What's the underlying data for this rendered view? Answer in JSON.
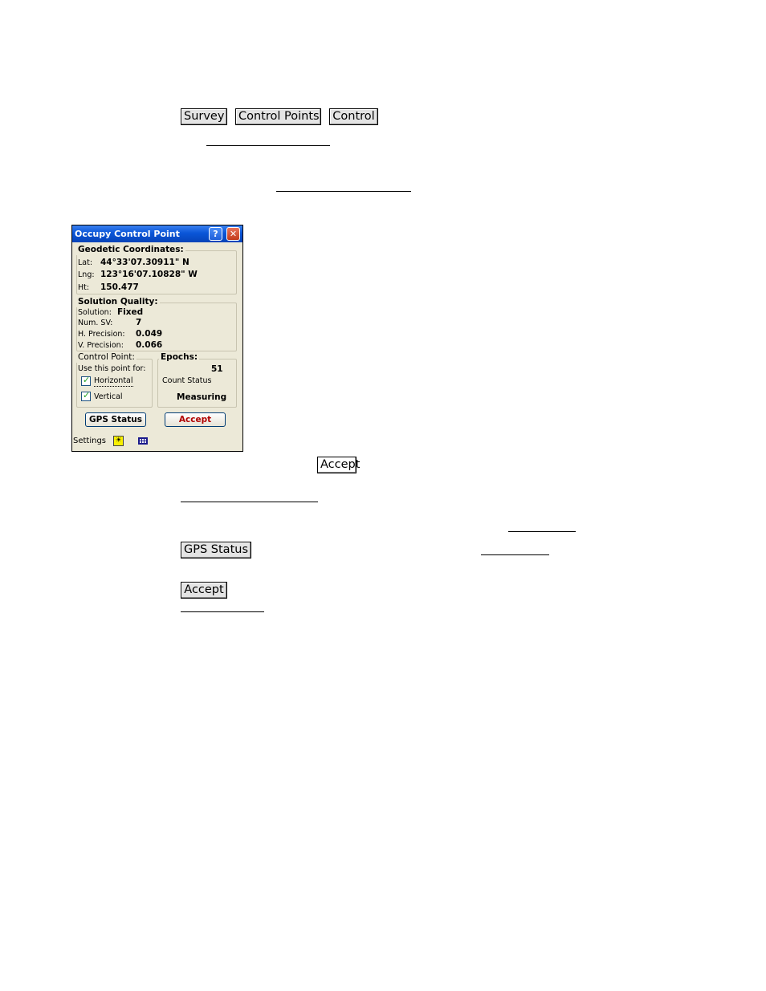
{
  "document": {
    "nav_buttons": [
      "Survey",
      "Control Points",
      "Control"
    ],
    "inline_accept_button": "Accept",
    "gps_status_button": "GPS Status",
    "accept_button": "Accept"
  },
  "dialog": {
    "title": "Occupy Control Point",
    "help_glyph": "?",
    "close_glyph": "✕",
    "geodetic": {
      "label": "Geodetic Coordinates:",
      "lat_label": "Lat:",
      "lat_value": "44°33'07.30911\" N",
      "lng_label": "Lng:",
      "lng_value": "123°16'07.10828\" W",
      "ht_label": "Ht:",
      "ht_value": "150.477"
    },
    "solution_quality": {
      "label": "Solution Quality:",
      "solution_label": "Solution:",
      "solution_value": "Fixed",
      "num_sv_label": "Num. SV:",
      "num_sv_value": "7",
      "h_precision_label": "H. Precision:",
      "h_precision_value": "0.049",
      "v_precision_label": "V. Precision:",
      "v_precision_value": "0.066"
    },
    "control_point": {
      "label": "Control Point:",
      "use_for_label": "Use this point for:",
      "horizontal_label": "Horizontal",
      "horizontal_checked": true,
      "vertical_label": "Vertical",
      "vertical_checked": true
    },
    "epochs": {
      "label": "Epochs:",
      "count": "51",
      "count_status_label": "Count Status",
      "status": "Measuring"
    },
    "buttons": {
      "gps_status": "GPS Status",
      "accept": "Accept"
    },
    "footer": {
      "settings_label": "Settings",
      "sun_icon": "sun-icon",
      "grid_icon": "grid-icon"
    },
    "colors": {
      "titlebar": "#0a56d8",
      "accept_text": "#b00000",
      "check": "#21a121"
    }
  }
}
